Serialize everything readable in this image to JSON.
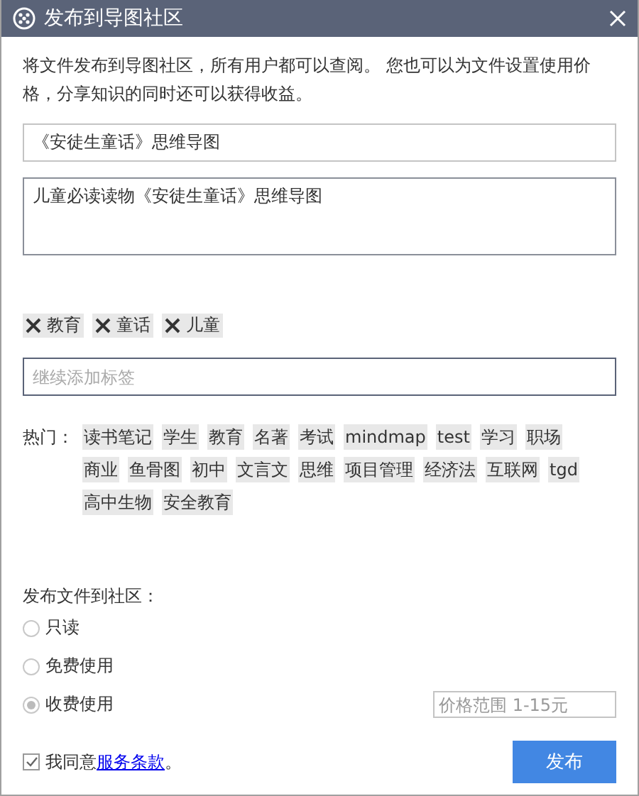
{
  "window": {
    "title": "发布到导图社区"
  },
  "description": "将文件发布到导图社区，所有用户都可以查阅。 您也可以为文件设置使用价格，分享知识的同时还可以获得收益。",
  "title_field": {
    "value": "《安徒生童话》思维导图"
  },
  "summary_field": {
    "value": "儿童必读读物《安徒生童话》思维导图"
  },
  "tags": [
    "教育",
    "童话",
    "儿童"
  ],
  "tag_field": {
    "placeholder": "继续添加标签"
  },
  "hot": {
    "label": "热门：",
    "tags": [
      "读书笔记",
      "学生",
      "教育",
      "名著",
      "考试",
      "mindmap",
      "test",
      "学习",
      "职场",
      "商业",
      "鱼骨图",
      "初中",
      "文言文",
      "思维",
      "项目管理",
      "经济法",
      "互联网",
      "tgd",
      "高中生物",
      "安全教育"
    ]
  },
  "publish": {
    "label": "发布文件到社区：",
    "options": [
      {
        "label": "只读",
        "selected": false
      },
      {
        "label": "免费使用",
        "selected": false
      },
      {
        "label": "收费使用",
        "selected": true
      }
    ],
    "price_field": {
      "placeholder": "价格范围 1-15元"
    }
  },
  "agreement": {
    "checked": true,
    "prefix": "我同意",
    "link": "服务条款",
    "suffix": "。"
  },
  "buttons": [
    "发布"
  ]
}
